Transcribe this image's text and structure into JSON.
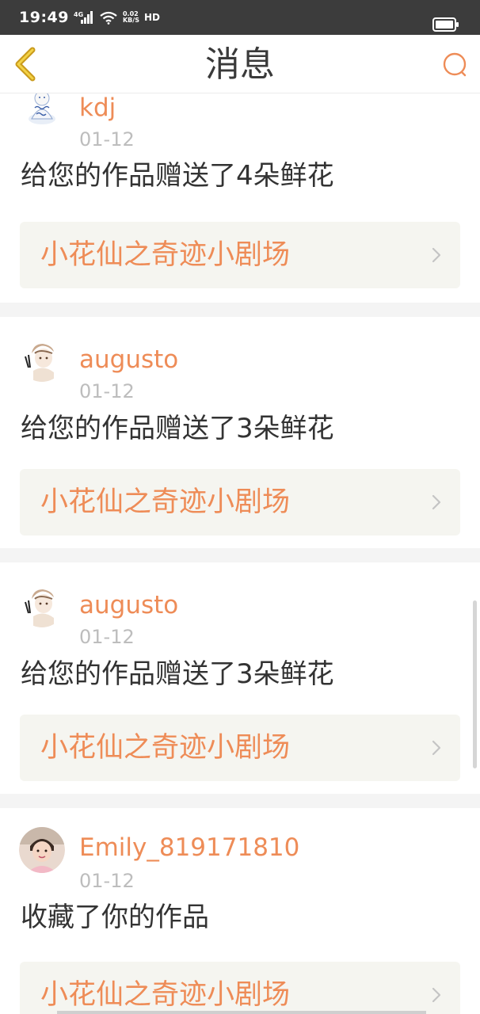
{
  "status": {
    "time": "19:49",
    "signal": "4G",
    "net_speed_value": "0.02",
    "net_speed_unit": "KB/S",
    "hd": "HD"
  },
  "header": {
    "title": "消息"
  },
  "colors": {
    "accent": "#ee8c57",
    "text": "#333333",
    "muted": "#bdbdbd",
    "card_bg": "#f5f5f0",
    "separator": "#f4f4f4"
  },
  "messages": [
    {
      "username": "kdj",
      "date": "01-12",
      "text": "给您的作品赠送了4朵鲜花",
      "work_title": "小花仙之奇迹小剧场",
      "avatar_icon": "porcelain-figure-avatar"
    },
    {
      "username": "augusto",
      "date": "01-12",
      "text": "给您的作品赠送了3朵鲜花",
      "work_title": "小花仙之奇迹小剧场",
      "avatar_icon": "anime-sketch-avatar"
    },
    {
      "username": "augusto",
      "date": "01-12",
      "text": "给您的作品赠送了3朵鲜花",
      "work_title": "小花仙之奇迹小剧场",
      "avatar_icon": "anime-sketch-avatar"
    },
    {
      "username": "Emily_819171810",
      "date": "01-12",
      "text": "收藏了你的作品",
      "work_title": "小花仙之奇迹小剧场",
      "avatar_icon": "child-photo-avatar"
    }
  ]
}
